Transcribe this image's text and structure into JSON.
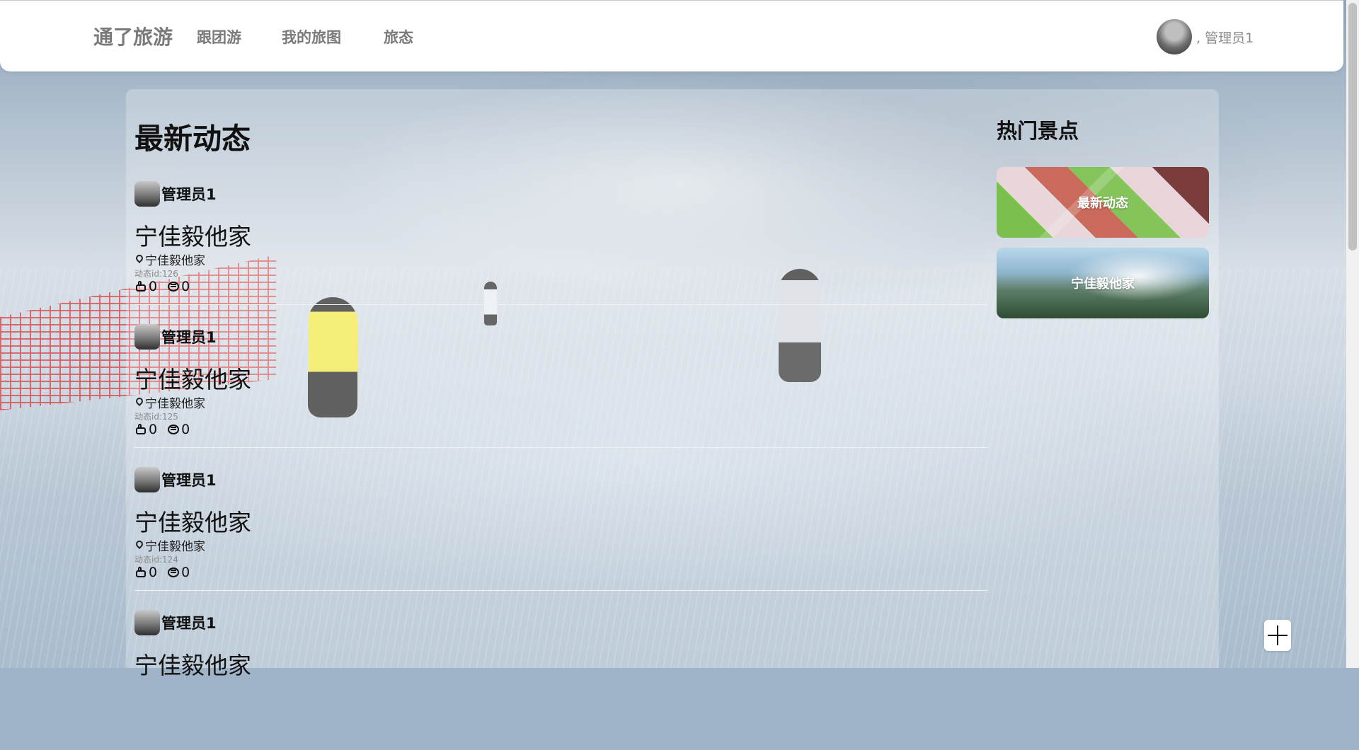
{
  "header": {
    "brand": "通了旅游",
    "nav": [
      "跟团游",
      "我的旅图",
      "旅态"
    ],
    "user_name": ", 管理员1"
  },
  "feed": {
    "title": "最新动态",
    "posts": [
      {
        "author": "管理员1",
        "title": "宁佳毅他家",
        "location": "宁佳毅他家",
        "post_id": "动态id:126",
        "likes": "0",
        "comments": "0"
      },
      {
        "author": "管理员1",
        "title": "宁佳毅他家",
        "location": "宁佳毅他家",
        "post_id": "动态id:125",
        "likes": "0",
        "comments": "0"
      },
      {
        "author": "管理员1",
        "title": "宁佳毅他家",
        "location": "宁佳毅他家",
        "post_id": "动态id:124",
        "likes": "0",
        "comments": "0"
      },
      {
        "author": "管理员1",
        "title": "宁佳毅他家"
      }
    ]
  },
  "sidebar": {
    "title": "热门景点",
    "spots": [
      {
        "label": "最新动态"
      },
      {
        "label": "宁佳毅他家"
      }
    ]
  },
  "icons": {
    "location": "map-pin-icon",
    "like": "thumbs-up-icon",
    "comment": "comment-icon",
    "add": "plus-icon"
  }
}
